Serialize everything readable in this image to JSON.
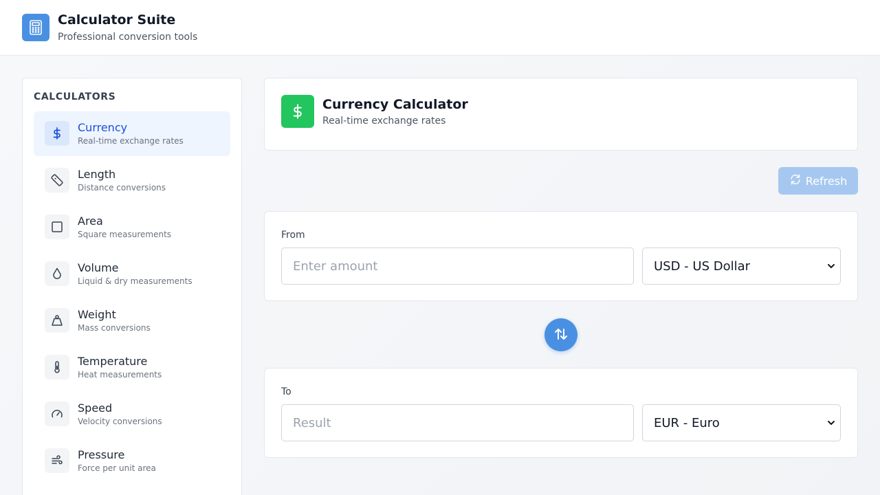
{
  "app": {
    "title": "Calculator Suite",
    "subtitle": "Professional conversion tools",
    "logo_icon": "calculator-icon",
    "accent": "#4a90e2"
  },
  "sidebar": {
    "heading": "CALCULATORS",
    "items": [
      {
        "label": "Currency",
        "desc": "Real-time exchange rates",
        "icon": "dollar-icon",
        "active": true
      },
      {
        "label": "Length",
        "desc": "Distance conversions",
        "icon": "ruler-icon",
        "active": false
      },
      {
        "label": "Area",
        "desc": "Square measurements",
        "icon": "square-icon",
        "active": false
      },
      {
        "label": "Volume",
        "desc": "Liquid & dry measurements",
        "icon": "droplet-icon",
        "active": false
      },
      {
        "label": "Weight",
        "desc": "Mass conversions",
        "icon": "weight-icon",
        "active": false
      },
      {
        "label": "Temperature",
        "desc": "Heat measurements",
        "icon": "thermometer-icon",
        "active": false
      },
      {
        "label": "Speed",
        "desc": "Velocity conversions",
        "icon": "gauge-icon",
        "active": false
      },
      {
        "label": "Pressure",
        "desc": "Force per unit area",
        "icon": "wind-icon",
        "active": false
      }
    ]
  },
  "calculator": {
    "title": "Currency Calculator",
    "subtitle": "Real-time exchange rates",
    "icon": "dollar-icon",
    "icon_color": "#22c55e"
  },
  "refresh": {
    "label": "Refresh",
    "icon": "refresh-icon"
  },
  "from": {
    "label": "From",
    "placeholder": "Enter amount",
    "value": "",
    "currency": "USD - US Dollar"
  },
  "swap": {
    "icon": "swap-arrows-icon"
  },
  "to": {
    "label": "To",
    "placeholder": "Result",
    "value": "",
    "currency": "EUR - Euro"
  }
}
